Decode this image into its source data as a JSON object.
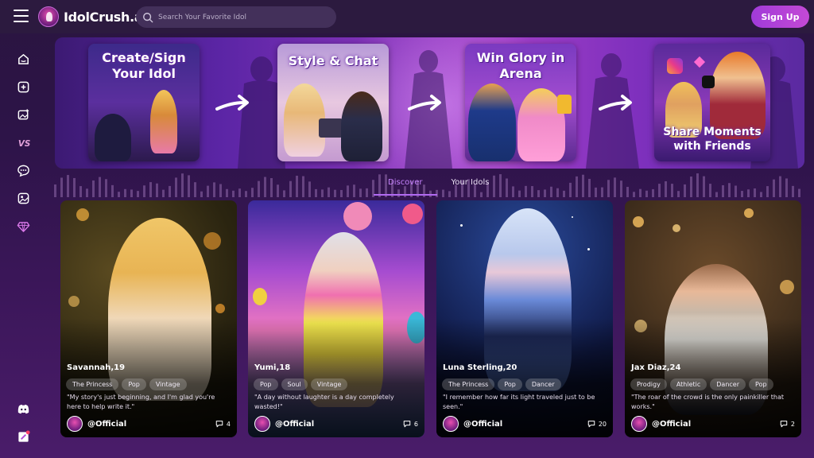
{
  "header": {
    "logo_text": "IdolCrush.ai",
    "search_placeholder": "Search Your Favorite Idol",
    "signup_label": "Sign Up"
  },
  "sidebar": {
    "icons": [
      "home-icon",
      "add-icon",
      "image-add-icon",
      "vs-icon",
      "chat-icon",
      "gallery-icon",
      "gem-icon",
      "discord-icon",
      "note-icon"
    ]
  },
  "banner": {
    "steps": [
      {
        "title_line1": "Create/Sign",
        "title_line2": "Your Idol"
      },
      {
        "title_line1": "Style & Chat",
        "title_line2": ""
      },
      {
        "title_line1": "Win Glory in",
        "title_line2": "Arena"
      },
      {
        "title_line1": "Share Moments",
        "title_line2": "with Friends"
      }
    ]
  },
  "tabs": [
    {
      "label": "Discover",
      "active": true
    },
    {
      "label": "Your Idols",
      "active": false
    }
  ],
  "cards": [
    {
      "name": "Savannah,19",
      "tags": [
        "The Princess",
        "Pop",
        "Vintage"
      ],
      "quote": "\"My story's just beginning, and I'm glad you're here to help write it.\"",
      "handle": "@Official",
      "count": "4",
      "accent": "#d8a648"
    },
    {
      "name": "Yumi,18",
      "tags": [
        "Pop",
        "Soul",
        "Vintage"
      ],
      "quote": "\"A day without laughter is a day completely wasted!\"",
      "handle": "@Official",
      "count": "6",
      "accent": "#e84f9a"
    },
    {
      "name": "Luna Sterling,20",
      "tags": [
        "The Princess",
        "Pop",
        "Dancer"
      ],
      "quote": "\"I remember how far its light traveled just to be seen.\"",
      "handle": "@Official",
      "count": "20",
      "accent": "#5d7fd8"
    },
    {
      "name": "Jax Diaz,24",
      "tags": [
        "Prodigy",
        "Athletic",
        "Dancer",
        "Pop"
      ],
      "quote": "\"The roar of the crowd is the only painkiller that works.\"",
      "handle": "@Official",
      "count": "2",
      "accent": "#e0a050"
    }
  ]
}
